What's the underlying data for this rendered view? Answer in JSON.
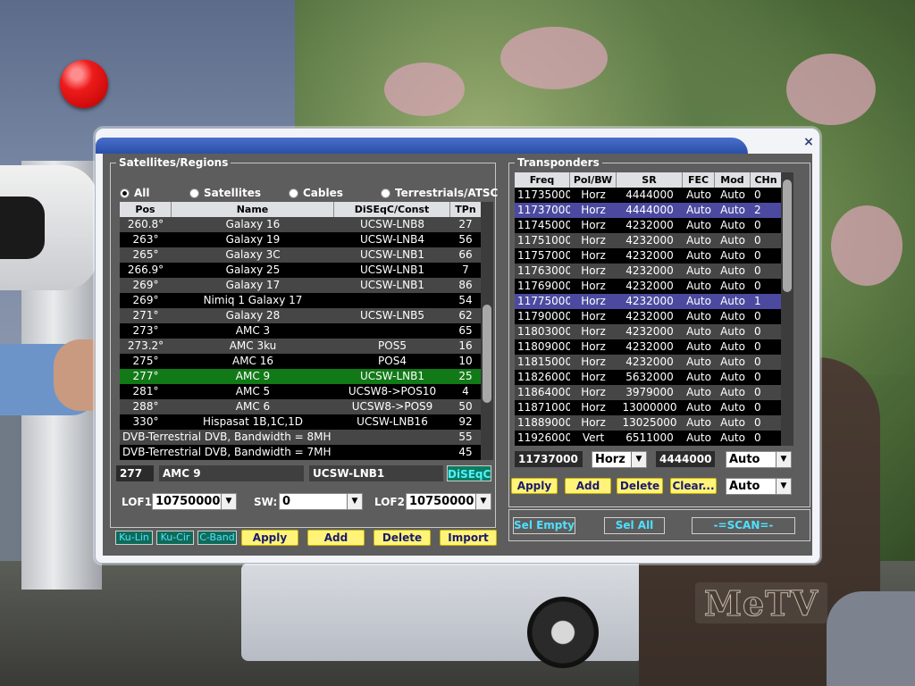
{
  "overlay": {
    "logo_text": "MeTV"
  },
  "dialog": {
    "close_glyph": "×",
    "satellites": {
      "group_title": "Satellites/Regions",
      "filters": [
        "All",
        "Satellites",
        "Cables",
        "Terrestrials/ATSC"
      ],
      "filter_selected": "All",
      "columns": [
        "Pos",
        "Name",
        "DiSEqC/Const",
        "TPn"
      ],
      "rows": [
        {
          "pos": "260.8°",
          "name": "Galaxy 16",
          "diseqc": "UCSW-LNB8",
          "tpn": "27"
        },
        {
          "pos": "263°",
          "name": "Galaxy 19",
          "diseqc": "UCSW-LNB4",
          "tpn": "56"
        },
        {
          "pos": "265°",
          "name": "Galaxy 3C",
          "diseqc": "UCSW-LNB1",
          "tpn": "66"
        },
        {
          "pos": "266.9°",
          "name": "Galaxy 25",
          "diseqc": "UCSW-LNB1",
          "tpn": "7"
        },
        {
          "pos": "269°",
          "name": "Galaxy 17",
          "diseqc": "UCSW-LNB1",
          "tpn": "86"
        },
        {
          "pos": "269°",
          "name": "Nimiq 1   Galaxy 17",
          "diseqc": "",
          "tpn": "54"
        },
        {
          "pos": "271°",
          "name": "Galaxy 28",
          "diseqc": "UCSW-LNB5",
          "tpn": "62"
        },
        {
          "pos": "273°",
          "name": "AMC 3",
          "diseqc": "",
          "tpn": "65"
        },
        {
          "pos": "273.2°",
          "name": "AMC 3ku",
          "diseqc": "POS5",
          "tpn": "16"
        },
        {
          "pos": "275°",
          "name": "AMC 16",
          "diseqc": "POS4",
          "tpn": "10"
        },
        {
          "pos": "277°",
          "name": "AMC 9",
          "diseqc": "UCSW-LNB1",
          "tpn": "25",
          "selected": true
        },
        {
          "pos": "281°",
          "name": "AMC 5",
          "diseqc": "UCSW8->POS10",
          "tpn": "4"
        },
        {
          "pos": "288°",
          "name": "AMC 6",
          "diseqc": "UCSW8->POS9",
          "tpn": "50"
        },
        {
          "pos": "330°",
          "name": "Hispasat 1B,1C,1D",
          "diseqc": "UCSW-LNB16",
          "tpn": "92"
        },
        {
          "pos": "DVB-Terrestrial DVB, Bandwidth = 8MH",
          "name": "",
          "diseqc": "",
          "tpn": "55",
          "span": true
        },
        {
          "pos": "DVB-Terrestrial DVB, Bandwidth = 7MH",
          "name": "",
          "diseqc": "",
          "tpn": "45",
          "span": true
        }
      ],
      "edit": {
        "pos": "277",
        "name": "AMC 9",
        "diseqc": "UCSW-LNB1",
        "diseqc_button": "DiSEqC"
      },
      "lof1_label": "LOF1:",
      "lof1_value": "10750000",
      "sw_label": "SW:",
      "sw_value": "0",
      "lof2_label": "LOF2:",
      "lof2_value": "10750000",
      "band_buttons": [
        "Ku-Lin",
        "Ku-Cir",
        "C-Band"
      ],
      "action_buttons": [
        "Apply",
        "Add",
        "Delete",
        "Import"
      ]
    },
    "transponders": {
      "group_title": "Transponders",
      "columns": [
        "Freq",
        "Pol/BW",
        "SR",
        "FEC",
        "Mod",
        "CHn"
      ],
      "rows": [
        {
          "freq": "11735000",
          "pol": "Horz",
          "sr": "4444000",
          "fec": "Auto",
          "mod": "Auto",
          "chn": "0"
        },
        {
          "freq": "11737000",
          "pol": "Horz",
          "sr": "4444000",
          "fec": "Auto",
          "mod": "Auto",
          "chn": "2",
          "highlight": true
        },
        {
          "freq": "11745000",
          "pol": "Horz",
          "sr": "4232000",
          "fec": "Auto",
          "mod": "Auto",
          "chn": "0"
        },
        {
          "freq": "11751000",
          "pol": "Horz",
          "sr": "4232000",
          "fec": "Auto",
          "mod": "Auto",
          "chn": "0"
        },
        {
          "freq": "11757000",
          "pol": "Horz",
          "sr": "4232000",
          "fec": "Auto",
          "mod": "Auto",
          "chn": "0"
        },
        {
          "freq": "11763000",
          "pol": "Horz",
          "sr": "4232000",
          "fec": "Auto",
          "mod": "Auto",
          "chn": "0"
        },
        {
          "freq": "11769000",
          "pol": "Horz",
          "sr": "4232000",
          "fec": "Auto",
          "mod": "Auto",
          "chn": "0"
        },
        {
          "freq": "11775000",
          "pol": "Horz",
          "sr": "4232000",
          "fec": "Auto",
          "mod": "Auto",
          "chn": "1",
          "highlight": true
        },
        {
          "freq": "11790000",
          "pol": "Horz",
          "sr": "4232000",
          "fec": "Auto",
          "mod": "Auto",
          "chn": "0"
        },
        {
          "freq": "11803000",
          "pol": "Horz",
          "sr": "4232000",
          "fec": "Auto",
          "mod": "Auto",
          "chn": "0"
        },
        {
          "freq": "11809000",
          "pol": "Horz",
          "sr": "4232000",
          "fec": "Auto",
          "mod": "Auto",
          "chn": "0"
        },
        {
          "freq": "11815000",
          "pol": "Horz",
          "sr": "4232000",
          "fec": "Auto",
          "mod": "Auto",
          "chn": "0"
        },
        {
          "freq": "11826000",
          "pol": "Horz",
          "sr": "5632000",
          "fec": "Auto",
          "mod": "Auto",
          "chn": "0"
        },
        {
          "freq": "11864000",
          "pol": "Horz",
          "sr": "3979000",
          "fec": "Auto",
          "mod": "Auto",
          "chn": "0"
        },
        {
          "freq": "11871000",
          "pol": "Horz",
          "sr": "13000000",
          "fec": "Auto",
          "mod": "Auto",
          "chn": "0"
        },
        {
          "freq": "11889000",
          "pol": "Horz",
          "sr": "13025000",
          "fec": "Auto",
          "mod": "Auto",
          "chn": "0"
        },
        {
          "freq": "11926000",
          "pol": "Vert",
          "sr": "6511000",
          "fec": "Auto",
          "mod": "Auto",
          "chn": "0"
        }
      ],
      "edit": {
        "freq": "11737000",
        "pol": "Horz",
        "sr": "4444000",
        "fec": "Auto",
        "mod": "Auto"
      },
      "action_buttons": [
        "Apply",
        "Add",
        "Delete",
        "Clear..."
      ],
      "bottom_buttons": [
        "Sel Empty",
        "Sel All",
        "-=SCAN=-"
      ]
    }
  }
}
